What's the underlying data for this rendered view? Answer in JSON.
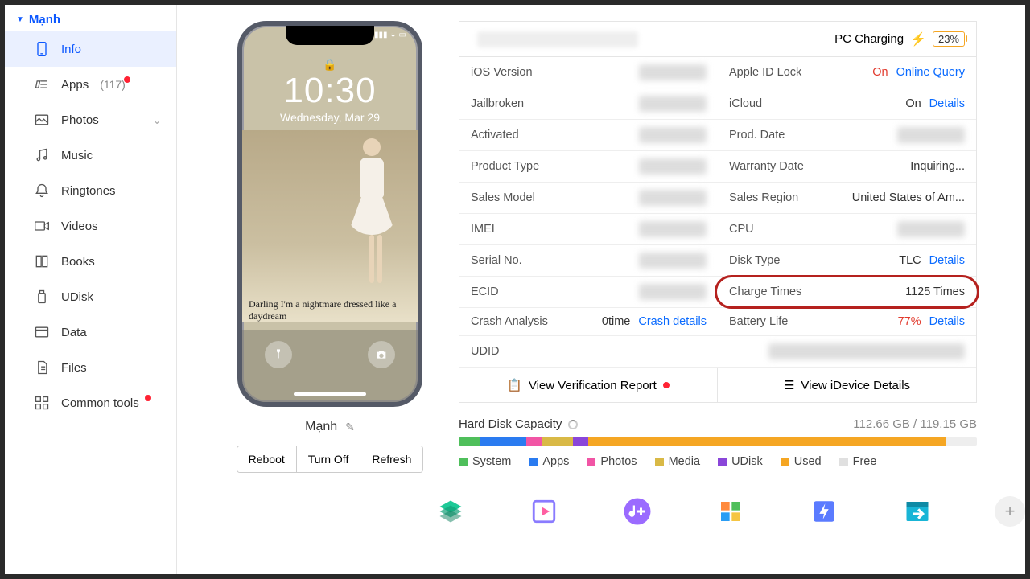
{
  "sidebar": {
    "device_name": "Mạnh",
    "items": [
      {
        "label": "Info"
      },
      {
        "label": "Apps",
        "count": "(117)",
        "dot": true
      },
      {
        "label": "Photos",
        "expand": true
      },
      {
        "label": "Music"
      },
      {
        "label": "Ringtones"
      },
      {
        "label": "Videos"
      },
      {
        "label": "Books"
      },
      {
        "label": "UDisk"
      },
      {
        "label": "Data"
      },
      {
        "label": "Files"
      },
      {
        "label": "Common tools",
        "dot": true
      }
    ]
  },
  "phone": {
    "time": "10:30",
    "date": "Wednesday, Mar 29",
    "wallpaper_text": "Darling I'm a nightmare dressed like a daydream",
    "name": "Mạnh",
    "buttons": {
      "reboot": "Reboot",
      "turnoff": "Turn Off",
      "refresh": "Refresh"
    }
  },
  "info": {
    "pc_charging_label": "PC Charging",
    "battery_pct": "23%",
    "left": [
      {
        "lbl": "iOS Version",
        "val": "",
        "blur": true
      },
      {
        "lbl": "Jailbroken",
        "val": "",
        "blur": true
      },
      {
        "lbl": "Activated",
        "val": "",
        "blur": true
      },
      {
        "lbl": "Product Type",
        "val": "",
        "blur": true
      },
      {
        "lbl": "Sales Model",
        "val": "",
        "blur": true
      },
      {
        "lbl": "IMEI",
        "val": "",
        "blur": true
      },
      {
        "lbl": "Serial No.",
        "val": "",
        "blur": true
      },
      {
        "lbl": "ECID",
        "val": "",
        "blur": true
      }
    ],
    "right": [
      {
        "lbl": "Apple ID Lock",
        "on": "On",
        "link": "Online Query"
      },
      {
        "lbl": "iCloud",
        "plain": "On",
        "link": "Details"
      },
      {
        "lbl": "Prod. Date",
        "blur": true
      },
      {
        "lbl": "Warranty Date",
        "plain": "Inquiring..."
      },
      {
        "lbl": "Sales Region",
        "plain": "United States of Am..."
      },
      {
        "lbl": "CPU",
        "blur": true
      },
      {
        "lbl": "Disk Type",
        "plain": "TLC",
        "link": "Details"
      },
      {
        "lbl": "Charge Times",
        "plain": "1125 Times",
        "highlight": true
      },
      {
        "lbl": "Battery Life",
        "on": "77%",
        "link": "Details"
      }
    ],
    "crash": {
      "lbl": "Crash Analysis",
      "val": "0time",
      "link": "Crash details"
    },
    "udid_lbl": "UDID",
    "btn1": "View Verification Report",
    "btn2": "View iDevice Details"
  },
  "disk": {
    "label": "Hard Disk Capacity",
    "cap": "112.66 GB / 119.15 GB",
    "segments": [
      {
        "color": "#4fbf5b",
        "pct": 4
      },
      {
        "color": "#2a7bf0",
        "pct": 9
      },
      {
        "color": "#f155a5",
        "pct": 3
      },
      {
        "color": "#d9b946",
        "pct": 6
      },
      {
        "color": "#8a46d9",
        "pct": 3
      },
      {
        "color": "#f5a623",
        "pct": 69
      }
    ],
    "legend": [
      {
        "color": "#4fbf5b",
        "label": "System"
      },
      {
        "color": "#2a7bf0",
        "label": "Apps"
      },
      {
        "color": "#f155a5",
        "label": "Photos"
      },
      {
        "color": "#d9b946",
        "label": "Media"
      },
      {
        "color": "#8a46d9",
        "label": "UDisk"
      },
      {
        "color": "#f5a623",
        "label": "Used"
      },
      {
        "color": "#e0e0e0",
        "label": "Free"
      }
    ]
  },
  "toolbar_icons": [
    "layers",
    "player",
    "music-plus",
    "windows",
    "flash",
    "window-arrow",
    "plus"
  ]
}
